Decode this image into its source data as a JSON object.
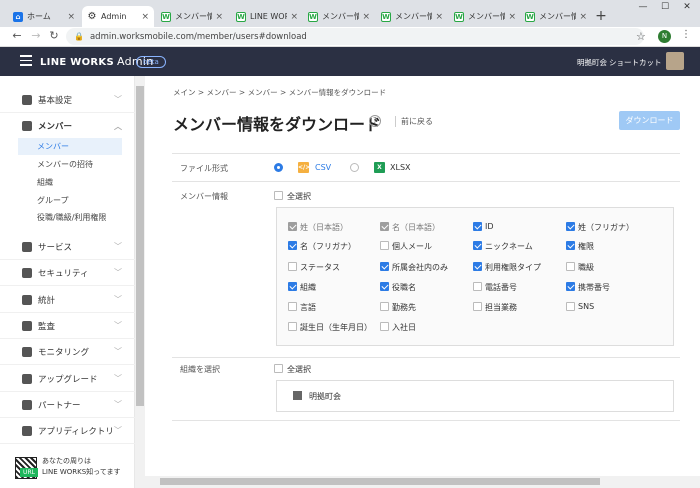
{
  "browser": {
    "tabs": [
      {
        "title": "ホーム",
        "icon": "home-icon"
      },
      {
        "title": "Admin",
        "icon": "gear-icon"
      },
      {
        "title": "メンバー情報",
        "icon": "lineworks-icon"
      },
      {
        "title": "LINE WORKS",
        "icon": "lineworks-icon"
      },
      {
        "title": "メンバー情報",
        "icon": "lineworks-icon"
      },
      {
        "title": "メンバー情報",
        "icon": "lineworks-icon"
      },
      {
        "title": "メンバー情報",
        "icon": "lineworks-icon"
      },
      {
        "title": "メンバー情報",
        "icon": "lineworks-icon"
      }
    ],
    "url": "admin.worksmobile.com/member/users#download",
    "profile_initial": "N"
  },
  "header": {
    "logo": "LINE WORKS",
    "logo_suffix": "Admin",
    "beta": "beta",
    "org": "明拠町会",
    "shortcut": "ショートカット"
  },
  "sidebar": {
    "items": [
      {
        "label": "基本設定"
      },
      {
        "label": "メンバー"
      },
      {
        "label": "サービス"
      },
      {
        "label": "セキュリティ"
      },
      {
        "label": "統計"
      },
      {
        "label": "監査"
      },
      {
        "label": "モニタリング"
      },
      {
        "label": "アップグレード"
      },
      {
        "label": "パートナー"
      },
      {
        "label": "アプリディレクトリ"
      }
    ],
    "subitems": [
      {
        "label": "メンバー"
      },
      {
        "label": "メンバーの招待"
      },
      {
        "label": "組織"
      },
      {
        "label": "グループ"
      },
      {
        "label": "役職/職級/利用権限"
      }
    ],
    "promo_line1": "あなたの周りは",
    "promo_line2": "LINE WORKS知ってます",
    "promo_tag": "URL"
  },
  "main": {
    "breadcrumb": "メイン > メンバー > メンバー > メンバー情報をダウンロード",
    "title": "メンバー情報をダウンロード",
    "help": "?",
    "back": "前に戻る",
    "download": "ダウンロード",
    "file_format_label": "ファイル形式",
    "csv": "CSV",
    "xlsx": "XLSX",
    "member_info_label": "メンバー情報",
    "select_all": "全選択",
    "fields": [
      {
        "label": "姓（日本語）",
        "state": "disabled-checked"
      },
      {
        "label": "名（日本語）",
        "state": "disabled-checked"
      },
      {
        "label": "ID",
        "state": "checked"
      },
      {
        "label": "姓（フリガナ）",
        "state": "checked"
      },
      {
        "label": "名（フリガナ）",
        "state": "checked"
      },
      {
        "label": "個人メール",
        "state": "unchecked"
      },
      {
        "label": "ニックネーム",
        "state": "checked"
      },
      {
        "label": "権限",
        "state": "checked"
      },
      {
        "label": "ステータス",
        "state": "unchecked"
      },
      {
        "label": "所属会社内のみ",
        "state": "checked"
      },
      {
        "label": "利用権限タイプ",
        "state": "checked"
      },
      {
        "label": "職級",
        "state": "unchecked"
      },
      {
        "label": "組織",
        "state": "checked"
      },
      {
        "label": "役職名",
        "state": "checked"
      },
      {
        "label": "電話番号",
        "state": "unchecked"
      },
      {
        "label": "携帯番号",
        "state": "checked"
      },
      {
        "label": "言語",
        "state": "unchecked"
      },
      {
        "label": "勤務先",
        "state": "unchecked"
      },
      {
        "label": "担当業務",
        "state": "unchecked"
      },
      {
        "label": "SNS",
        "state": "unchecked"
      },
      {
        "label": "誕生日（生年月日）",
        "state": "unchecked"
      },
      {
        "label": "入社日",
        "state": "unchecked"
      }
    ],
    "org_select_label": "組織を選択",
    "org_select_all": "全選択",
    "org_name": "明拠町会"
  },
  "colors": {
    "accent": "#2c7be5",
    "header_bg": "#2b3043"
  }
}
